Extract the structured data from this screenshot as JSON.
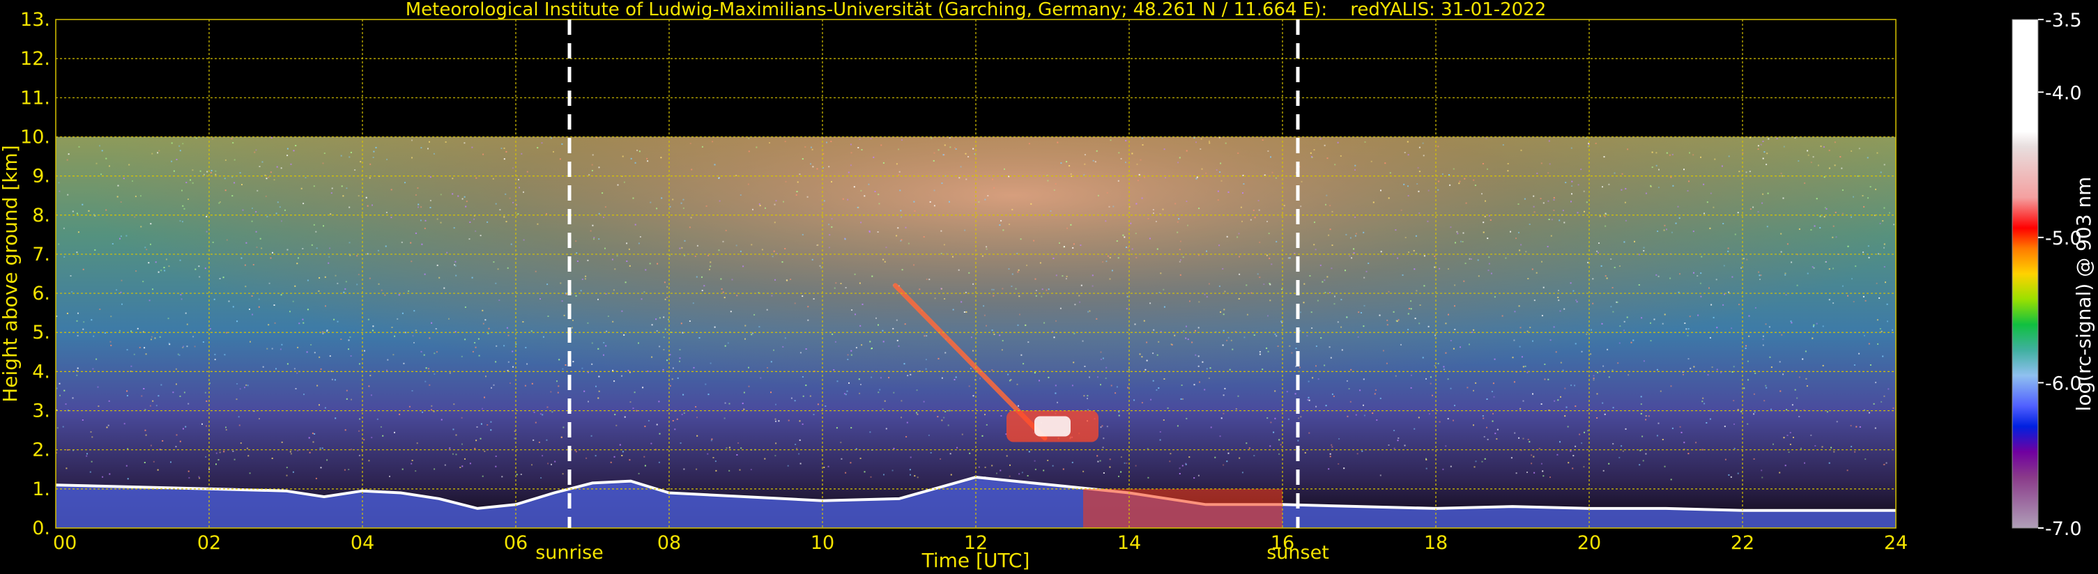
{
  "chart_data": {
    "type": "heatmap",
    "title": "Meteorological Institute of Ludwig-Maximilians-Universität (Garching, Germany; 48.261 N / 11.664 E):    redYALIS: 31-01-2022",
    "xlabel": "Time [UTC]",
    "ylabel": "Height above ground [km]",
    "xlim": [
      0,
      24
    ],
    "ylim": [
      0,
      13
    ],
    "x_ticks": [
      "00",
      "02",
      "04",
      "06",
      "08",
      "10",
      "12",
      "14",
      "16",
      "18",
      "20",
      "22",
      "24"
    ],
    "y_ticks": [
      "0.",
      "1.",
      "2.",
      "3.",
      "4.",
      "5.",
      "6.",
      "7.",
      "8.",
      "9.",
      "10.",
      "11.",
      "12.",
      "13."
    ],
    "grid": true,
    "measurement_top_km": 10,
    "annotations": [
      {
        "label": "sunrise",
        "time": 6.7
      },
      {
        "label": "sunset",
        "time": 16.2
      }
    ],
    "colorbar": {
      "label": "log(rc-signal) @ 903 nm",
      "range": [
        -7.0,
        -3.5
      ],
      "ticks": [
        "-3.5",
        "-4.0",
        "-5.0",
        "-6.0",
        "-7.0"
      ],
      "tick_values": [
        -3.5,
        -4.0,
        -5.0,
        -6.0,
        -7.0
      ]
    },
    "boundary_layer_top_km": {
      "time": [
        0,
        1,
        2,
        3,
        3.5,
        4,
        4.5,
        5,
        5.5,
        6,
        6.5,
        7,
        7.5,
        8,
        9,
        10,
        11,
        12,
        13,
        14,
        15,
        16,
        17,
        18,
        19,
        20,
        21,
        22,
        23,
        24
      ],
      "height": [
        1.1,
        1.05,
        1.0,
        0.95,
        0.8,
        0.95,
        0.9,
        0.75,
        0.5,
        0.6,
        0.9,
        1.15,
        1.2,
        0.9,
        0.8,
        0.7,
        0.75,
        1.3,
        1.1,
        0.9,
        0.6,
        0.6,
        0.55,
        0.5,
        0.55,
        0.5,
        0.5,
        0.45,
        0.45,
        0.45
      ]
    },
    "features": [
      {
        "name": "falling streak",
        "time": [
          10.95,
          12.9
        ],
        "height": [
          6.2,
          2.3
        ]
      },
      {
        "name": "cloud",
        "time": [
          12.4,
          13.6
        ],
        "height": [
          2.2,
          3.0
        ]
      },
      {
        "name": "aerosol layer",
        "time": [
          13.4,
          16.0
        ],
        "height": [
          0.0,
          1.0
        ]
      }
    ],
    "palette": {
      "text": "#f4e300",
      "grid": "#d8c400",
      "marker": "#ffffff",
      "background": "#000000"
    }
  }
}
